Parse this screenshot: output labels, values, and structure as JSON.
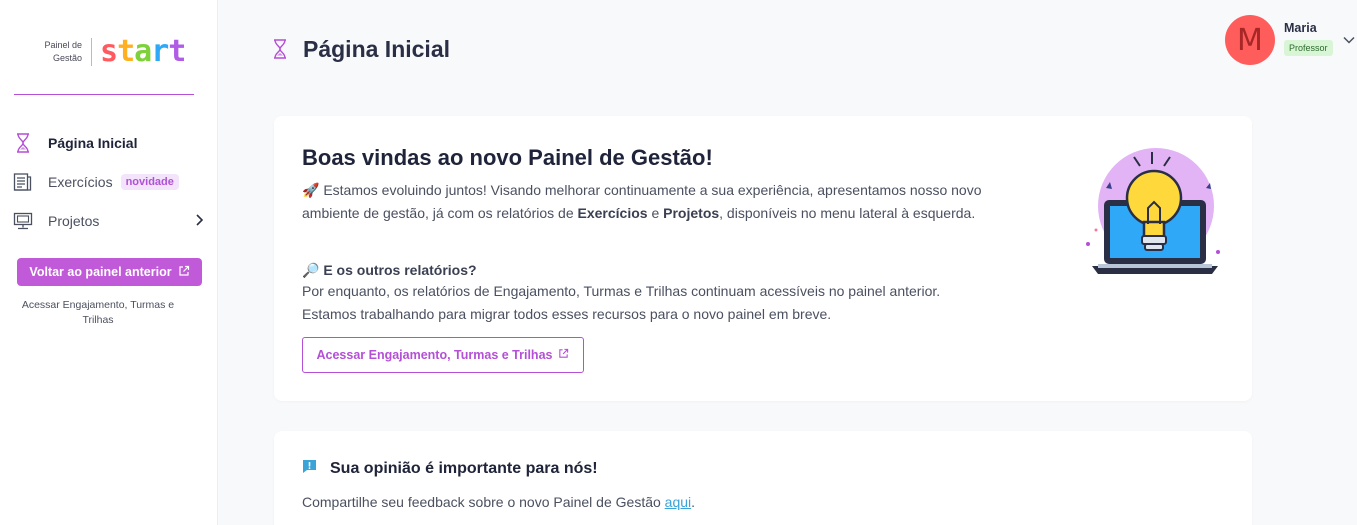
{
  "sidebar": {
    "logo_small_line1": "Painel de",
    "logo_small_line2": "Gestão",
    "logo_letters": [
      "s",
      "t",
      "a",
      "r",
      "t"
    ],
    "items": [
      {
        "label": "Página Inicial",
        "icon": "hourglass-icon",
        "active": true
      },
      {
        "label": "Exercícios",
        "icon": "document-icon",
        "badge": "novidade"
      },
      {
        "label": "Projetos",
        "icon": "monitor-icon",
        "has_submenu": true
      }
    ],
    "back_button": "Voltar ao painel anterior",
    "note": "Acessar Engajamento, Turmas e Trilhas"
  },
  "header": {
    "title": "Página Inicial",
    "icon": "hourglass-icon"
  },
  "user": {
    "initial": "M",
    "name": "Maria",
    "role": "Professor"
  },
  "welcome": {
    "title": "Boas vindas ao novo Painel de Gestão!",
    "p1_emoji": "🚀",
    "p1_a": "Estamos evoluindo juntos",
    "p1_b": "! Visando melhorar continuamente a sua experiência, apresentamos nosso novo ambiente de gestão, já com os relatórios de ",
    "p1_exercicios": "Exercícios",
    "p1_c": " e ",
    "p1_projetos": "Projetos",
    "p1_d": ", disponíveis no menu lateral à esquerda.",
    "sub_emoji": "🔎",
    "sub_title": "E os outros relatórios?",
    "p2": "Por enquanto, os relatórios de Engajamento, Turmas e Trilhas continuam acessíveis no painel anterior. Estamos trabalhando para migrar todos esses recursos para o novo painel em breve.",
    "button": "Acessar Engajamento, Turmas e Trilhas"
  },
  "feedback": {
    "title": "Sua opinião é importante para nós!",
    "text": "Compartilhe seu feedback sobre o novo Painel de Gestão ",
    "link": "aqui",
    "after": "."
  },
  "colors": {
    "accent": "#c15ad9",
    "badge_bg": "#f3e3fb",
    "avatar": "#ff5c5c",
    "role_bg": "#d8f5d6",
    "link": "#3aa3d8"
  }
}
